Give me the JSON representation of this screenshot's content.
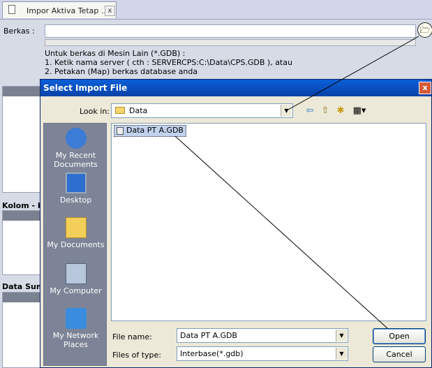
{
  "tab": {
    "title": "Impor Aktiva Tetap ...",
    "close_glyph": "x"
  },
  "form": {
    "berkas_label": "Berkas :",
    "browse_glyph": "🗁",
    "info_lines": [
      "Untuk berkas di Mesin Lain (*.GDB) :",
      "1. Ketik nama server ( cth : SERVERCPS:C:\\Data\\CPS.GDB ), atau",
      "2. Petakan (Map) berkas database anda"
    ]
  },
  "panels": [
    {
      "label": ""
    },
    {
      "label": "Kolom - k"
    },
    {
      "label": "Data Sum"
    }
  ],
  "dialog": {
    "title": "Select Import File",
    "close_glyph": "x",
    "look_in_label": "Look in:",
    "look_in_value": "Data",
    "toolbar": {
      "back": "⇦",
      "up": "⇧",
      "new_folder": "✱",
      "views": "▦▾"
    },
    "places": [
      {
        "label": "My Recent Documents",
        "icon": "recent-documents-icon",
        "color": "#3c7bd6"
      },
      {
        "label": "Desktop",
        "icon": "desktop-icon",
        "color": "#2d6fd0"
      },
      {
        "label": "My Documents",
        "icon": "my-documents-icon",
        "color": "#f3cf5a"
      },
      {
        "label": "My Computer",
        "icon": "my-computer-icon",
        "color": "#b9c7dc"
      },
      {
        "label": "My Network Places",
        "icon": "network-places-icon",
        "color": "#3a8dde"
      }
    ],
    "files": [
      {
        "name": "Data PT A.GDB",
        "selected": true
      }
    ],
    "file_name_label": "File name:",
    "file_name_value": "Data PT A.GDB",
    "file_type_label": "Files of type:",
    "file_type_value": "Interbase(*.gdb)",
    "open_label": "Open",
    "cancel_label": "Cancel"
  }
}
